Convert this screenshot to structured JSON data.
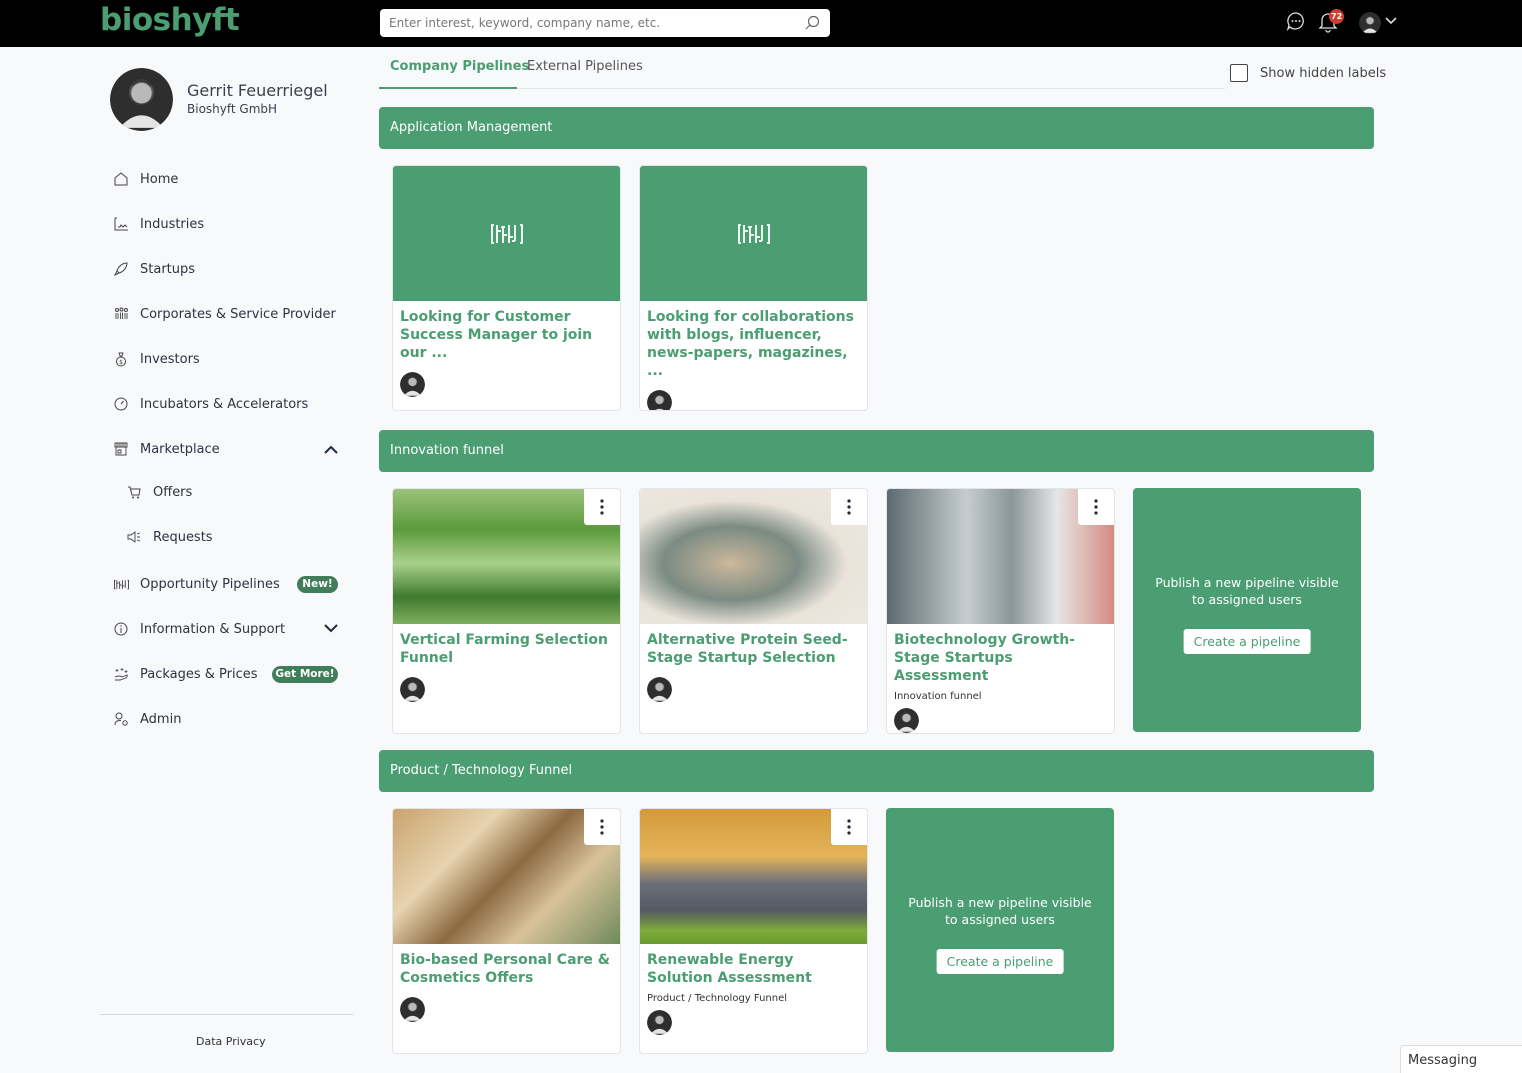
{
  "app": {
    "logo": "bioshyft",
    "search_placeholder": "Enter interest, keyword, company name, etc.",
    "search_value": "",
    "notification_count": "72",
    "brand_color": "#4a9e72"
  },
  "user": {
    "name": "Gerrit Feuerriegel",
    "company": "Bioshyft GmbH"
  },
  "sidebar": {
    "items": [
      {
        "label": "Home",
        "icon": "home-icon"
      },
      {
        "label": "Industries",
        "icon": "factory-icon"
      },
      {
        "label": "Startups",
        "icon": "rocket-icon"
      },
      {
        "label": "Corporates & Service Provider",
        "icon": "people-group-icon"
      },
      {
        "label": "Investors",
        "icon": "money-bag-icon"
      },
      {
        "label": "Incubators & Accelerators",
        "icon": "speedometer-icon"
      },
      {
        "label": "Marketplace",
        "icon": "store-icon",
        "expanded": true
      },
      {
        "label": "Offers",
        "icon": "cart-icon"
      },
      {
        "label": "Requests",
        "icon": "megaphone-icon"
      },
      {
        "label": "Opportunity Pipelines",
        "icon": "pipeline-icon",
        "badge": "New!"
      },
      {
        "label": "Information & Support",
        "icon": "info-icon",
        "expanded": false
      },
      {
        "label": "Packages & Prices",
        "icon": "sparkle-hand-icon",
        "badge": "Get More!"
      },
      {
        "label": "Admin",
        "icon": "user-gear-icon"
      }
    ],
    "footer_link": "Data Privacy"
  },
  "tabs": {
    "items": [
      "Company Pipelines",
      "External Pipelines"
    ],
    "active": "Company Pipelines",
    "show_hidden_labels": "Show hidden labels",
    "show_hidden_checked": false
  },
  "sections": [
    {
      "title": "Application Management",
      "cards": [
        {
          "title": "Looking for Customer Success Manager to join our ...",
          "subtitle": "",
          "image": "pipeline-icon"
        },
        {
          "title": "Looking for collaborations with blogs, influencer, news-papers, magazines, ...",
          "subtitle": "",
          "image": "pipeline-icon"
        }
      ]
    },
    {
      "title": "Innovation funnel",
      "cards": [
        {
          "title": "Vertical Farming Selection Funnel",
          "subtitle": "",
          "image": "vertical-farming-photo"
        },
        {
          "title": "Alternative Protein Seed-Stage Startup Selection",
          "subtitle": "",
          "image": "protein-food-photo"
        },
        {
          "title": "Biotechnology Growth-Stage Startups Assessment",
          "subtitle": "Innovation funnel",
          "image": "bioreactor-photo"
        }
      ],
      "create": {
        "text": "Publish a new pipeline visible to assigned users",
        "button": "Create a pipeline"
      }
    },
    {
      "title": "Product / Technology Funnel",
      "cards": [
        {
          "title": "Bio-based Personal Care & Cosmetics Offers",
          "subtitle": "",
          "image": "cosmetics-photo"
        },
        {
          "title": "Renewable Energy Solution Assessment",
          "subtitle": "Product / Technology Funnel",
          "image": "solar-wind-photo"
        }
      ],
      "create": {
        "text": "Publish a new pipeline visible to assigned users",
        "button": "Create a pipeline"
      }
    }
  ],
  "messaging": "Messaging"
}
